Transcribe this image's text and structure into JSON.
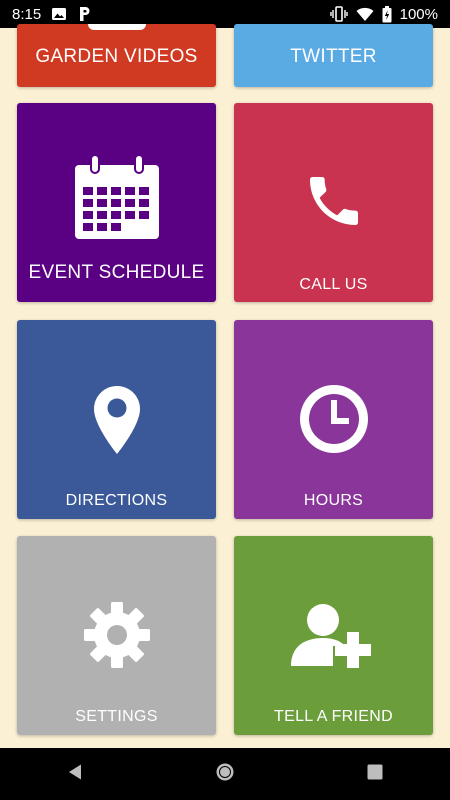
{
  "status_bar": {
    "time": "8:15",
    "battery": "100%",
    "icons": [
      "image-icon",
      "parking-icon",
      "vibrate-icon",
      "wifi-icon",
      "battery-icon"
    ]
  },
  "tiles": {
    "garden_videos": {
      "label": "GARDEN VIDEOS",
      "color": "#d03a22"
    },
    "twitter": {
      "label": "TWITTER",
      "color": "#5aaae4"
    },
    "event_schedule": {
      "label": "EVENT SCHEDULE",
      "color": "#5a0183",
      "icon": "calendar-icon"
    },
    "call_us": {
      "label": "CALL US",
      "color": "#c9334f",
      "icon": "phone-icon"
    },
    "directions": {
      "label": "DIRECTIONS",
      "color": "#3b5998",
      "icon": "map-pin-icon"
    },
    "hours": {
      "label": "HOURS",
      "color": "#8a3599",
      "icon": "clock-icon"
    },
    "settings": {
      "label": "SETTINGS",
      "color": "#b1b1b1",
      "icon": "gear-icon"
    },
    "tell_a_friend": {
      "label": "TELL A FRIEND",
      "color": "#6b9d3b",
      "icon": "add-user-icon"
    }
  },
  "nav_bar": {
    "buttons": [
      "back-icon",
      "home-icon",
      "recents-icon"
    ]
  }
}
